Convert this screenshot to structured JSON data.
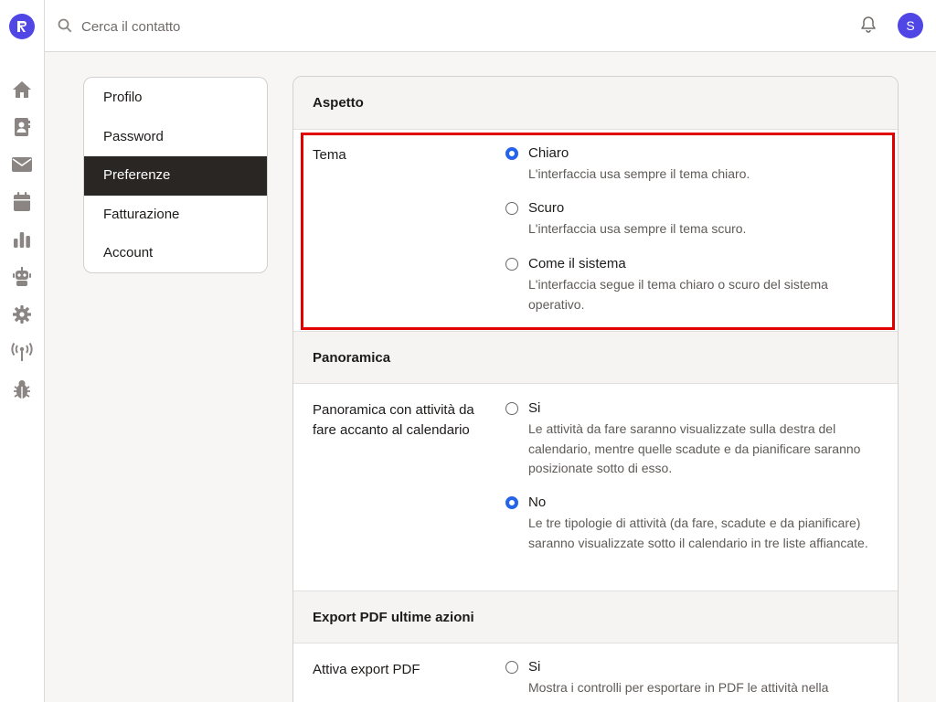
{
  "search": {
    "placeholder": "Cerca il contatto"
  },
  "user": {
    "avatar_initial": "S"
  },
  "rail": {
    "logo_icon": "brand-logo-icon",
    "items": [
      {
        "icon": "home-icon"
      },
      {
        "icon": "contacts-icon"
      },
      {
        "icon": "mail-icon"
      },
      {
        "icon": "calendar-icon"
      },
      {
        "icon": "chart-icon"
      },
      {
        "icon": "robot-icon"
      },
      {
        "icon": "gear-icon"
      },
      {
        "icon": "antenna-icon"
      },
      {
        "icon": "bug-icon"
      }
    ]
  },
  "subnav": {
    "items": [
      {
        "label": "Profilo"
      },
      {
        "label": "Password"
      },
      {
        "label": "Preferenze",
        "active": true
      },
      {
        "label": "Fatturazione"
      },
      {
        "label": "Account"
      }
    ]
  },
  "sections": {
    "aspetto": {
      "title": "Aspetto",
      "row_label": "Tema",
      "options": [
        {
          "label": "Chiaro",
          "desc": "L'interfaccia usa sempre il tema chiaro.",
          "selected": true
        },
        {
          "label": "Scuro",
          "desc": "L'interfaccia usa sempre il tema scuro.",
          "selected": false
        },
        {
          "label": "Come il sistema",
          "desc": "L'interfaccia segue il tema chiaro o scuro del sistema operativo.",
          "selected": false
        }
      ]
    },
    "panoramica": {
      "title": "Panoramica",
      "row_label": "Panoramica con attività da fare accanto al calendario",
      "options": [
        {
          "label": "Si",
          "desc": "Le attività da fare saranno visualizzate sulla destra del calendario, mentre quelle scadute e da pianificare saranno posizionate sotto di esso.",
          "selected": false
        },
        {
          "label": "No",
          "desc": "Le tre tipologie di attività (da fare, scadute e da pianificare) saranno visualizzate sotto il calendario in tre liste affiancate.",
          "selected": true
        }
      ]
    },
    "export": {
      "title": "Export PDF ultime azioni",
      "row_label": "Attiva export PDF",
      "options": [
        {
          "label": "Si",
          "desc": "Mostra i controlli per esportare in PDF le attività nella",
          "selected": false
        }
      ]
    }
  },
  "colors": {
    "accent": "#2563eb",
    "brand": "#4f46e5",
    "active_nav": "#2a2624",
    "highlight": "#e00000"
  }
}
